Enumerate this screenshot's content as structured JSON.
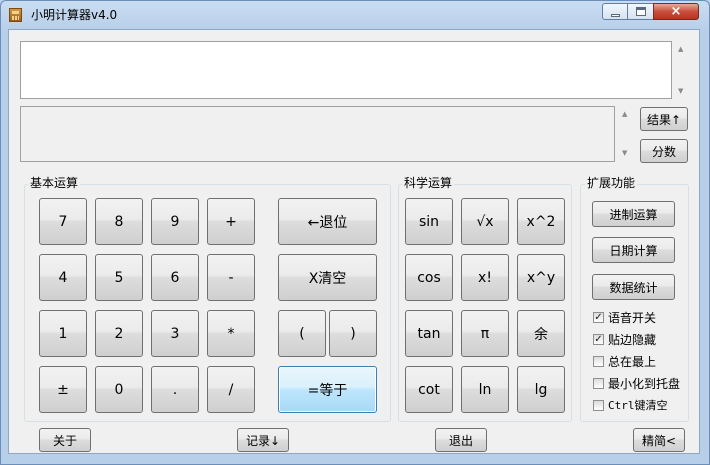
{
  "window": {
    "title": "小明计算器v4.0",
    "controls": {
      "close": "×"
    }
  },
  "sections": {
    "basic": "基本运算",
    "science": "科学运算",
    "extend": "扩展功能"
  },
  "side_buttons": {
    "result": "结果↑",
    "fraction": "分数"
  },
  "basic_keys": [
    "7",
    "8",
    "9",
    "+",
    "4",
    "5",
    "6",
    "-",
    "1",
    "2",
    "3",
    "*",
    "±",
    "0",
    ".",
    "/"
  ],
  "edit_keys": {
    "backspace": "←退位",
    "clear": "X清空",
    "lparen": "(",
    "rparen": ")",
    "equals": "=等于"
  },
  "science_keys": [
    "sin",
    "√x",
    "x^2",
    "cos",
    "x!",
    "x^y",
    "tan",
    "π",
    "余",
    "cot",
    "ln",
    "lg"
  ],
  "extend_buttons": [
    "进制运算",
    "日期计算",
    "数据统计"
  ],
  "options": [
    {
      "label": "语音开关",
      "checked": true
    },
    {
      "label": "贴边隐藏",
      "checked": true
    },
    {
      "label": "总在最上",
      "checked": false
    },
    {
      "label": "最小化到托盘",
      "checked": false
    },
    {
      "label": "Ctrl键清空",
      "checked": false
    }
  ],
  "bottom": {
    "about": "关于",
    "record": "记录↓",
    "exit": "退出",
    "precise": "精简<"
  },
  "check_mark": "✓"
}
